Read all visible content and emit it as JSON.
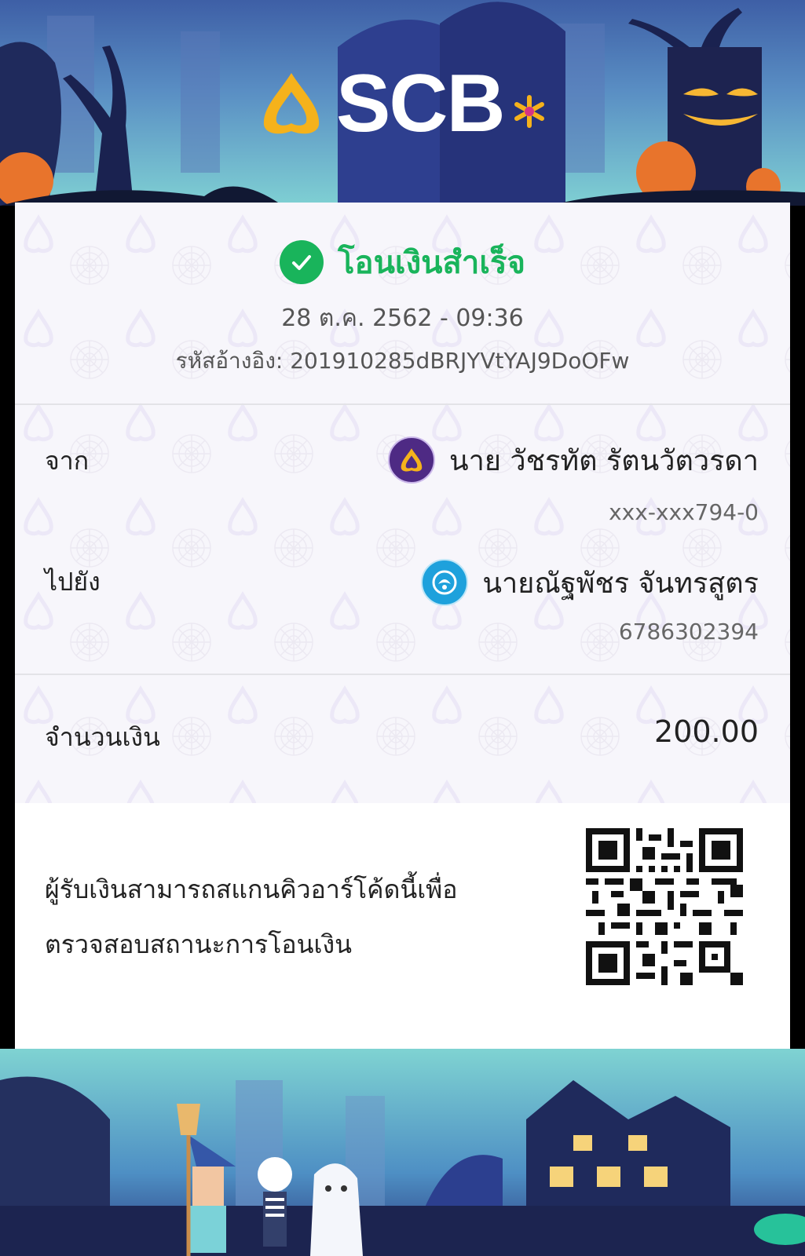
{
  "brand": {
    "name": "SCB"
  },
  "status": {
    "text": "โอนเงินสำเร็จ",
    "color": "#19b45b",
    "icon": "check-circle-icon"
  },
  "transaction": {
    "datetime": "28 ต.ค. 2562 - 09:36",
    "reference": "รหัสอ้างอิง: 201910285dBRJYVtYAJ9DoOFw"
  },
  "from": {
    "label": "จาก",
    "name": "นาย วัชรทัต รัตนวัตวรดา",
    "account": "xxx-xxx794-0",
    "bank_icon": "scb-bank-icon"
  },
  "to": {
    "label": "ไปยัง",
    "name": "นายณัฐพัชร จันทรสูตร",
    "account": "6786302394",
    "bank_icon": "ktb-bank-icon"
  },
  "amount": {
    "label": "จำนวนเงิน",
    "value": "200.00"
  },
  "verification": {
    "note_line1": "ผู้รับเงินสามารถสแกนคิวอาร์โค้ดนี้เพื่อ",
    "note_line2": "ตรวจสอบสถานะการโอนเงิน"
  },
  "colors": {
    "brand_purple": "#4e2a84",
    "brand_gold": "#f5b21b",
    "success_green": "#19b45b"
  }
}
